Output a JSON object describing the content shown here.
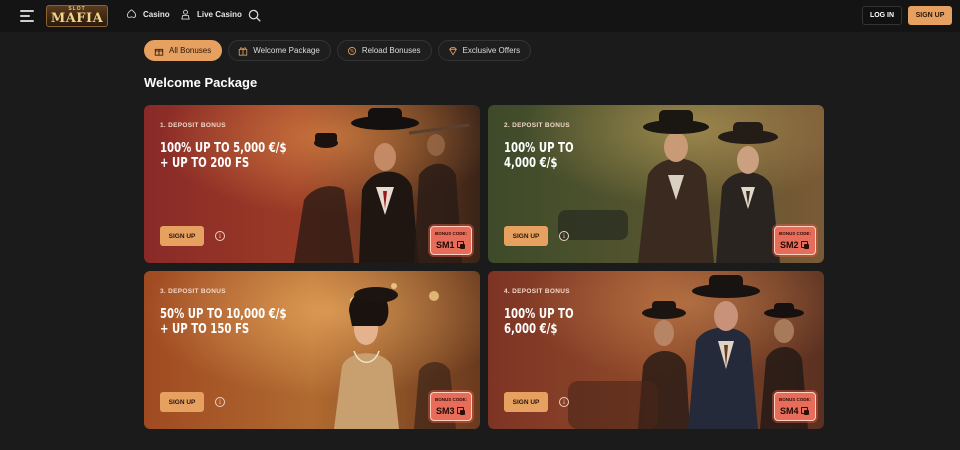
{
  "header": {
    "logo_top": "SLOT",
    "logo_main": "MAFIA",
    "nav": [
      {
        "label": "Casino",
        "icon": "casino-icon"
      },
      {
        "label": "Live Casino",
        "icon": "live-dealer-icon"
      }
    ],
    "login_label": "LOG IN",
    "signup_label": "SIGN UP"
  },
  "tabs": [
    {
      "label": "All Bonuses",
      "icon": "gift-icon",
      "active": true
    },
    {
      "label": "Welcome Package",
      "icon": "gift-box-icon",
      "active": false
    },
    {
      "label": "Reload Bonuses",
      "icon": "reload-icon",
      "active": false
    },
    {
      "label": "Exclusive Offers",
      "icon": "diamond-icon",
      "active": false
    }
  ],
  "section_title": "Welcome Package",
  "cards": [
    {
      "label": "1. DEPOSIT BONUS",
      "headline": "100% UP TO 5,000 €/$\n+ UP TO 200 FS",
      "cta": "SIGN UP",
      "info": "i",
      "code_caption": "BONUS CODE:",
      "code": "SM1",
      "theme": "#8a2a28"
    },
    {
      "label": "2. DEPOSIT BONUS",
      "headline": "100% UP TO\n4,000 €/$",
      "cta": "SIGN UP",
      "info": "i",
      "code_caption": "BONUS CODE:",
      "code": "SM2",
      "theme": "#3e4a2a"
    },
    {
      "label": "3. DEPOSIT BONUS",
      "headline": "50% UP TO 10,000 €/$\n+ UP TO 150 FS",
      "cta": "SIGN UP",
      "info": "i",
      "code_caption": "BONUS CODE:",
      "code": "SM3",
      "theme": "#a04a22"
    },
    {
      "label": "4. DEPOSIT BONUS",
      "headline": "100% UP TO\n6,000 €/$",
      "cta": "SIGN UP",
      "info": "i",
      "code_caption": "BONUS CODE:",
      "code": "SM4",
      "theme": "#7e3424"
    }
  ]
}
